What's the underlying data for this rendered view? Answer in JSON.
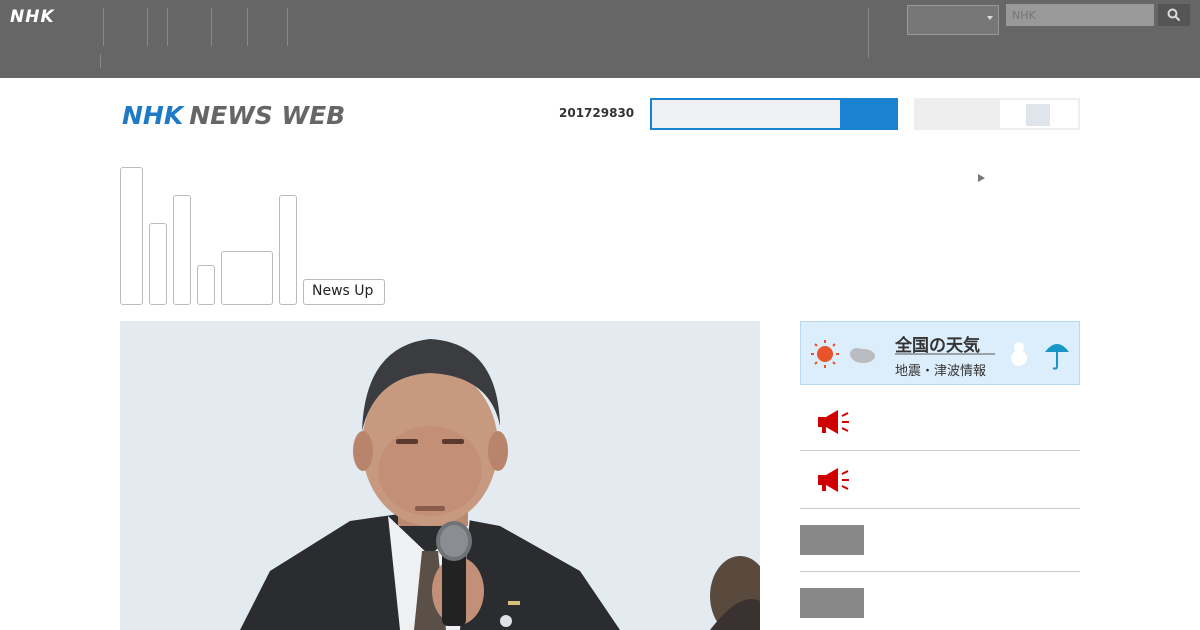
{
  "global_header": {
    "logo": "NHK",
    "nav_items": [
      "",
      "",
      "",
      "",
      "",
      ""
    ],
    "lang_select": "",
    "search_placeholder": "NHK"
  },
  "site_header": {
    "logo_nhk": "NHK",
    "logo_sub": "NEWS WEB",
    "date": "201729830",
    "search_value": "",
    "toggle_label": ""
  },
  "tabs": {
    "t1": "",
    "t2": "",
    "t3": "",
    "t4": "",
    "t5": "",
    "t6": "",
    "t7": "News Up"
  },
  "more_link": "",
  "weather": {
    "title": "全国の天気",
    "subtitle": "地震・津波情報"
  },
  "sidebar_items": [
    {
      "label": "",
      "icon": "megaphone-icon"
    },
    {
      "label": "",
      "icon": "megaphone-icon"
    },
    {
      "label": "",
      "icon": "thumbnail"
    },
    {
      "label": "",
      "icon": "thumbnail"
    }
  ],
  "colors": {
    "brand_blue": "#1e7ac6",
    "search_blue": "#1983d1",
    "alert_red": "#d00000",
    "header_gray": "#666666",
    "link_blue": "#1b5e94"
  }
}
